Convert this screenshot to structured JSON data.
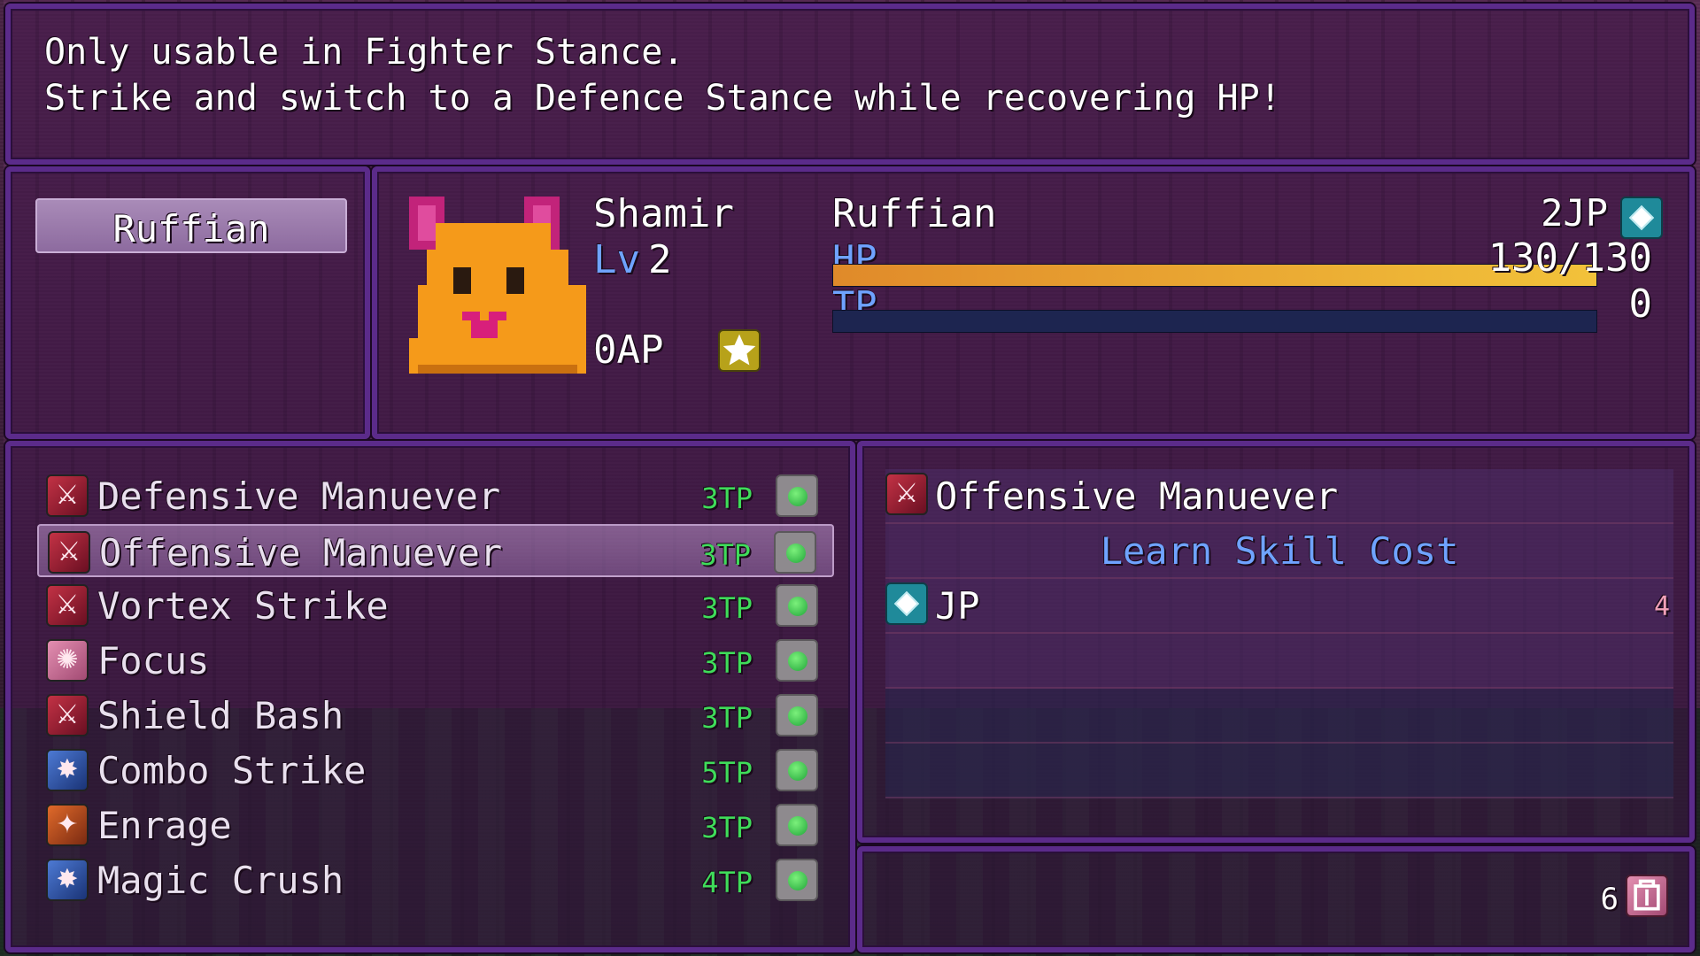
{
  "help": {
    "line1": "Only usable in Fighter Stance.",
    "line2": "Strike and switch to a Defence Stance while recovering HP!"
  },
  "class_list": {
    "selected": "Ruffian"
  },
  "actor": {
    "name": "Shamir",
    "class": "Ruffian",
    "level_label": "Lv",
    "level": "2",
    "jp_text": "2JP",
    "ap_text": "0AP",
    "hp_label": "HP",
    "hp_text": "130/130",
    "hp_fraction": 1.0,
    "tp_label": "TP",
    "tp_text": "0",
    "tp_fraction": 0.0,
    "colors": {
      "hp_start": "#e08a2a",
      "hp_end": "#f2c23a",
      "label_blue": "#6fa3ff",
      "slime": "#f59a1a",
      "ears": "#c2237a"
    }
  },
  "skills": [
    {
      "name": "Defensive Manuever",
      "cost": "3TP",
      "icon": "sword-slash-icon",
      "color": "red"
    },
    {
      "name": "Offensive Manuever",
      "cost": "3TP",
      "icon": "sword-slash-icon",
      "color": "red",
      "selected": true
    },
    {
      "name": "Vortex Strike",
      "cost": "3TP",
      "icon": "sword-slash-icon",
      "color": "red"
    },
    {
      "name": "Focus",
      "cost": "3TP",
      "icon": "sparkle-icon",
      "color": "pink"
    },
    {
      "name": "Shield Bash",
      "cost": "3TP",
      "icon": "sword-slash-icon",
      "color": "red"
    },
    {
      "name": "Combo Strike",
      "cost": "5TP",
      "icon": "burst-icon",
      "color": "blue"
    },
    {
      "name": "Enrage",
      "cost": "3TP",
      "icon": "fox-face-icon",
      "color": "orange"
    },
    {
      "name": "Magic Crush",
      "cost": "4TP",
      "icon": "burst-icon",
      "color": "blue"
    }
  ],
  "skill_info": {
    "name": "Offensive Manuever",
    "header": "Learn Skill Cost",
    "cost_label": "JP",
    "cost_value": "4"
  },
  "footer": {
    "count": "6"
  }
}
